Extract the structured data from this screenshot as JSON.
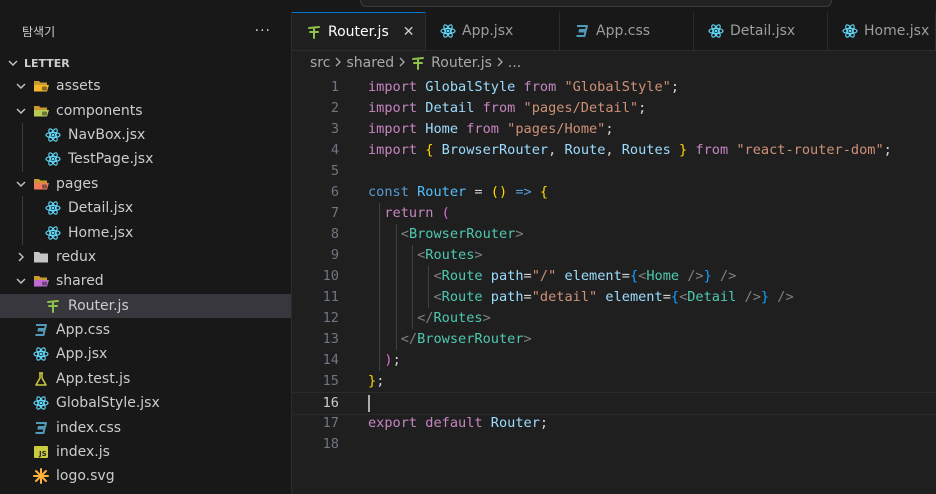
{
  "sidebar": {
    "title": "탐색기",
    "more": "···",
    "section": "LETTER",
    "tree": [
      {
        "label": "assets",
        "type": "folder",
        "depth": 1,
        "open": true,
        "icon": "assets-folder-icon"
      },
      {
        "label": "components",
        "type": "folder",
        "depth": 1,
        "open": true,
        "icon": "components-folder-icon"
      },
      {
        "label": "NavBox.jsx",
        "type": "react",
        "depth": 2
      },
      {
        "label": "TestPage.jsx",
        "type": "react",
        "depth": 2
      },
      {
        "label": "pages",
        "type": "folder",
        "depth": 1,
        "open": true,
        "icon": "pages-folder-icon"
      },
      {
        "label": "Detail.jsx",
        "type": "react",
        "depth": 2
      },
      {
        "label": "Home.jsx",
        "type": "react",
        "depth": 2
      },
      {
        "label": "redux",
        "type": "folder",
        "depth": 1,
        "open": false,
        "icon": "folder-icon"
      },
      {
        "label": "shared",
        "type": "folder",
        "depth": 1,
        "open": true,
        "icon": "shared-folder-icon"
      },
      {
        "label": "Router.js",
        "type": "router",
        "depth": 2,
        "selected": true
      },
      {
        "label": "App.css",
        "type": "css",
        "depth": 1
      },
      {
        "label": "App.jsx",
        "type": "react",
        "depth": 1
      },
      {
        "label": "App.test.js",
        "type": "test",
        "depth": 1
      },
      {
        "label": "GlobalStyle.jsx",
        "type": "react",
        "depth": 1
      },
      {
        "label": "index.css",
        "type": "css",
        "depth": 1
      },
      {
        "label": "index.js",
        "type": "js",
        "depth": 1
      },
      {
        "label": "logo.svg",
        "type": "svg",
        "depth": 1
      }
    ]
  },
  "tabs": [
    {
      "label": "Router.js",
      "type": "router",
      "active": true,
      "close": "✕"
    },
    {
      "label": "App.jsx",
      "type": "react"
    },
    {
      "label": "App.css",
      "type": "css"
    },
    {
      "label": "Detail.jsx",
      "type": "react"
    },
    {
      "label": "Home.jsx",
      "type": "react"
    }
  ],
  "breadcrumb": [
    "src",
    "shared",
    "Router.js",
    "..."
  ],
  "editor": {
    "current_line": 16,
    "lines": [
      [
        [
          "kw",
          "import "
        ],
        [
          "var",
          "GlobalStyle"
        ],
        [
          "kw",
          " from "
        ],
        [
          "str",
          "\"GlobalStyle\""
        ],
        [
          "op",
          ";"
        ]
      ],
      [
        [
          "kw",
          "import "
        ],
        [
          "var",
          "Detail"
        ],
        [
          "kw",
          " from "
        ],
        [
          "str",
          "\"pages/Detail\""
        ],
        [
          "op",
          ";"
        ]
      ],
      [
        [
          "kw",
          "import "
        ],
        [
          "var",
          "Home"
        ],
        [
          "kw",
          " from "
        ],
        [
          "str",
          "\"pages/Home\""
        ],
        [
          "op",
          ";"
        ]
      ],
      [
        [
          "kw",
          "import "
        ],
        [
          "br1",
          "{ "
        ],
        [
          "var",
          "BrowserRouter"
        ],
        [
          "op",
          ", "
        ],
        [
          "var",
          "Route"
        ],
        [
          "op",
          ", "
        ],
        [
          "var",
          "Routes"
        ],
        [
          "br1",
          " }"
        ],
        [
          "kw",
          " from "
        ],
        [
          "str",
          "\"react-router-dom\""
        ],
        [
          "op",
          ";"
        ]
      ],
      [],
      [
        [
          "kb",
          "const "
        ],
        [
          "cls",
          "Router"
        ],
        [
          "op",
          " = "
        ],
        [
          "br1",
          "()"
        ],
        [
          "kb",
          " => "
        ],
        [
          "br1",
          "{"
        ]
      ],
      [
        [
          "op",
          "  "
        ],
        [
          "kw",
          "return "
        ],
        [
          "br2",
          "("
        ]
      ],
      [
        [
          "op",
          "    "
        ],
        [
          "ang",
          "<"
        ],
        [
          "tag",
          "BrowserRouter"
        ],
        [
          "ang",
          ">"
        ]
      ],
      [
        [
          "op",
          "      "
        ],
        [
          "ang",
          "<"
        ],
        [
          "tag",
          "Routes"
        ],
        [
          "ang",
          ">"
        ]
      ],
      [
        [
          "op",
          "        "
        ],
        [
          "ang",
          "<"
        ],
        [
          "tag",
          "Route "
        ],
        [
          "attr",
          "path"
        ],
        [
          "op",
          "="
        ],
        [
          "str",
          "\"/\""
        ],
        [
          "attr",
          " element"
        ],
        [
          "op",
          "="
        ],
        [
          "br3",
          "{"
        ],
        [
          "ang",
          "<"
        ],
        [
          "tag",
          "Home "
        ],
        [
          "ang",
          "/>"
        ],
        [
          "br3",
          "}"
        ],
        [
          "ang",
          " />"
        ]
      ],
      [
        [
          "op",
          "        "
        ],
        [
          "ang",
          "<"
        ],
        [
          "tag",
          "Route "
        ],
        [
          "attr",
          "path"
        ],
        [
          "op",
          "="
        ],
        [
          "str",
          "\"detail\""
        ],
        [
          "attr",
          " element"
        ],
        [
          "op",
          "="
        ],
        [
          "br3",
          "{"
        ],
        [
          "ang",
          "<"
        ],
        [
          "tag",
          "Detail "
        ],
        [
          "ang",
          "/>"
        ],
        [
          "br3",
          "}"
        ],
        [
          "ang",
          " />"
        ]
      ],
      [
        [
          "op",
          "      "
        ],
        [
          "ang",
          "</"
        ],
        [
          "tag",
          "Routes"
        ],
        [
          "ang",
          ">"
        ]
      ],
      [
        [
          "op",
          "    "
        ],
        [
          "ang",
          "</"
        ],
        [
          "tag",
          "BrowserRouter"
        ],
        [
          "ang",
          ">"
        ]
      ],
      [
        [
          "op",
          "  "
        ],
        [
          "br2",
          ")"
        ],
        [
          "op",
          ";"
        ]
      ],
      [
        [
          "br1",
          "}"
        ],
        [
          "op",
          ";"
        ]
      ],
      [],
      [
        [
          "kw",
          "export "
        ],
        [
          "kw",
          "default "
        ],
        [
          "var",
          "Router"
        ],
        [
          "op",
          ";"
        ]
      ],
      []
    ]
  }
}
